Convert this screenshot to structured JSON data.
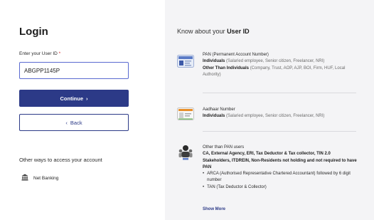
{
  "login": {
    "title": "Login",
    "user_id_label": "Enter your User ID",
    "required_mark": "*",
    "user_id_value": "ABGPP1145P",
    "continue_label": "Continue",
    "continue_icon": "›",
    "back_label": "Back",
    "back_icon": "‹",
    "other_ways": "Other ways to access your account",
    "net_banking": "Net Banking",
    "net_banking_icon": "bank-icon"
  },
  "info": {
    "title_prefix": "Know about your",
    "title_emphasis": "User ID",
    "pan": {
      "icon": "pan-card-icon",
      "heading": "PAN (Permanent Account Number)",
      "individuals_label": "Individuals",
      "individuals_desc": "(Salaried employee, Senior citizen, Freelancer, NRI)",
      "others_label": "Other Than Individuals",
      "others_desc": "(Company, Trust, AOP, AJP, BOI, Firm, HUF, Local Authority)"
    },
    "aadhaar": {
      "icon": "aadhaar-card-icon",
      "heading": "Aadhaar Number",
      "individuals_label": "Individuals",
      "individuals_desc": "(Salaried employee, Senior citizen, Freelancer, NRI)"
    },
    "other_users": {
      "icon": "user-group-icon",
      "heading": "Other than PAN users",
      "list": "CA, External Agency, ERI, Tax Deductor & Tax collector, TIN 2.0 Stakeholders, ITDREIN, Non-Residents not holding and not required to have PAN",
      "bullets": [
        "ARCA (Authorised Representative Chartered Accountant) followed by 6 digit number",
        "TAN (Tax Deductor & Collector)"
      ]
    },
    "show_more": "Show More"
  },
  "colors": {
    "primary": "#2c3a87",
    "panel_bg": "#f4f4f6",
    "required": "#d42a2a"
  }
}
